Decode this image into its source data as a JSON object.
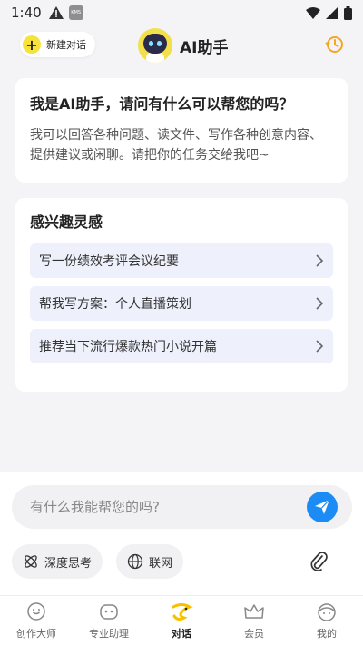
{
  "status_bar": {
    "time": "1:40",
    "kms_label": "KMS"
  },
  "header": {
    "new_chat_label": "新建对话",
    "title": "AI助手"
  },
  "intro": {
    "title": "我是AI助手，请问有什么可以帮您的吗？",
    "description": "我可以回答各种问题、读文件、写作各种创意内容、提供建议或闲聊。请把你的任务交给我吧~"
  },
  "inspiration": {
    "title": "感兴趣灵感",
    "items": [
      {
        "label": "写一份绩效考评会议纪要"
      },
      {
        "label": "帮我写方案：个人直播策划"
      },
      {
        "label": "推荐当下流行爆款热门小说开篇"
      }
    ]
  },
  "composer": {
    "placeholder": "有什么我能帮您的吗?",
    "deep_think_label": "深度思考",
    "web_label": "联网"
  },
  "tabs": [
    {
      "label": "创作大师",
      "icon": "bulb-face-icon"
    },
    {
      "label": "专业助理",
      "icon": "robot-icon"
    },
    {
      "label": "对话",
      "icon": "chat-icon",
      "active": true
    },
    {
      "label": "会员",
      "icon": "crown-icon"
    },
    {
      "label": "我的",
      "icon": "profile-face-icon"
    }
  ],
  "colors": {
    "accent_yellow": "#f6e23a",
    "send_blue": "#1b8cf5",
    "chip_bg": "#eef0fb",
    "history_orange": "#f5a623"
  }
}
